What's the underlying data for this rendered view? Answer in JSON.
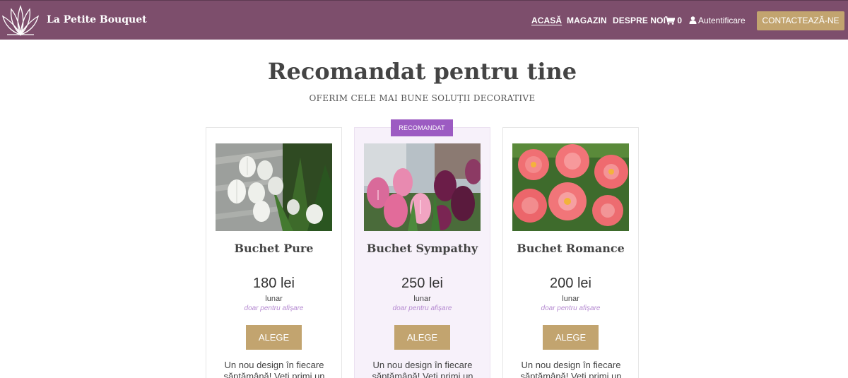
{
  "nav": {
    "brand": "La Petite Bouquet",
    "links": [
      "ACASĂ",
      "MAGAZIN",
      "DESPRE NOI"
    ],
    "cart_count": "0",
    "login": "Autentificare",
    "contact": "CONTACTEAZĂ-NE"
  },
  "section": {
    "title": "Recomandat pentru tine",
    "subtitle": "OFERIM CELE MAI BUNE SOLUȚII DECORATIVE"
  },
  "badge": "RECOMANDAT",
  "cards": [
    {
      "title": "Buchet Pure",
      "price": "180 lei",
      "period": "lunar",
      "note": "doar pentru afișare",
      "button": "ALEGE",
      "description": "Un nou design în fiecare săptămână! Veți primi un"
    },
    {
      "title": "Buchet Sympathy",
      "price": "250 lei",
      "period": "lunar",
      "note": "doar pentru afișare",
      "button": "ALEGE",
      "description": "Un nou design în fiecare săptămână! Veți primi un"
    },
    {
      "title": "Buchet Romance",
      "price": "200 lei",
      "period": "lunar",
      "note": "doar pentru afișare",
      "button": "ALEGE",
      "description": "Un nou design în fiecare săptămână! Veți primi un"
    }
  ],
  "colors": {
    "navbar": "#7d4e6c",
    "accent_gold": "#c2a46f",
    "badge_purple": "#9c5bc2",
    "featured_bg": "#f7f1fa",
    "note_lavender": "#b58ad1"
  },
  "icons": {
    "logo": "lotus-flower-icon",
    "cart": "shopping-cart-icon",
    "login": "user-icon"
  }
}
